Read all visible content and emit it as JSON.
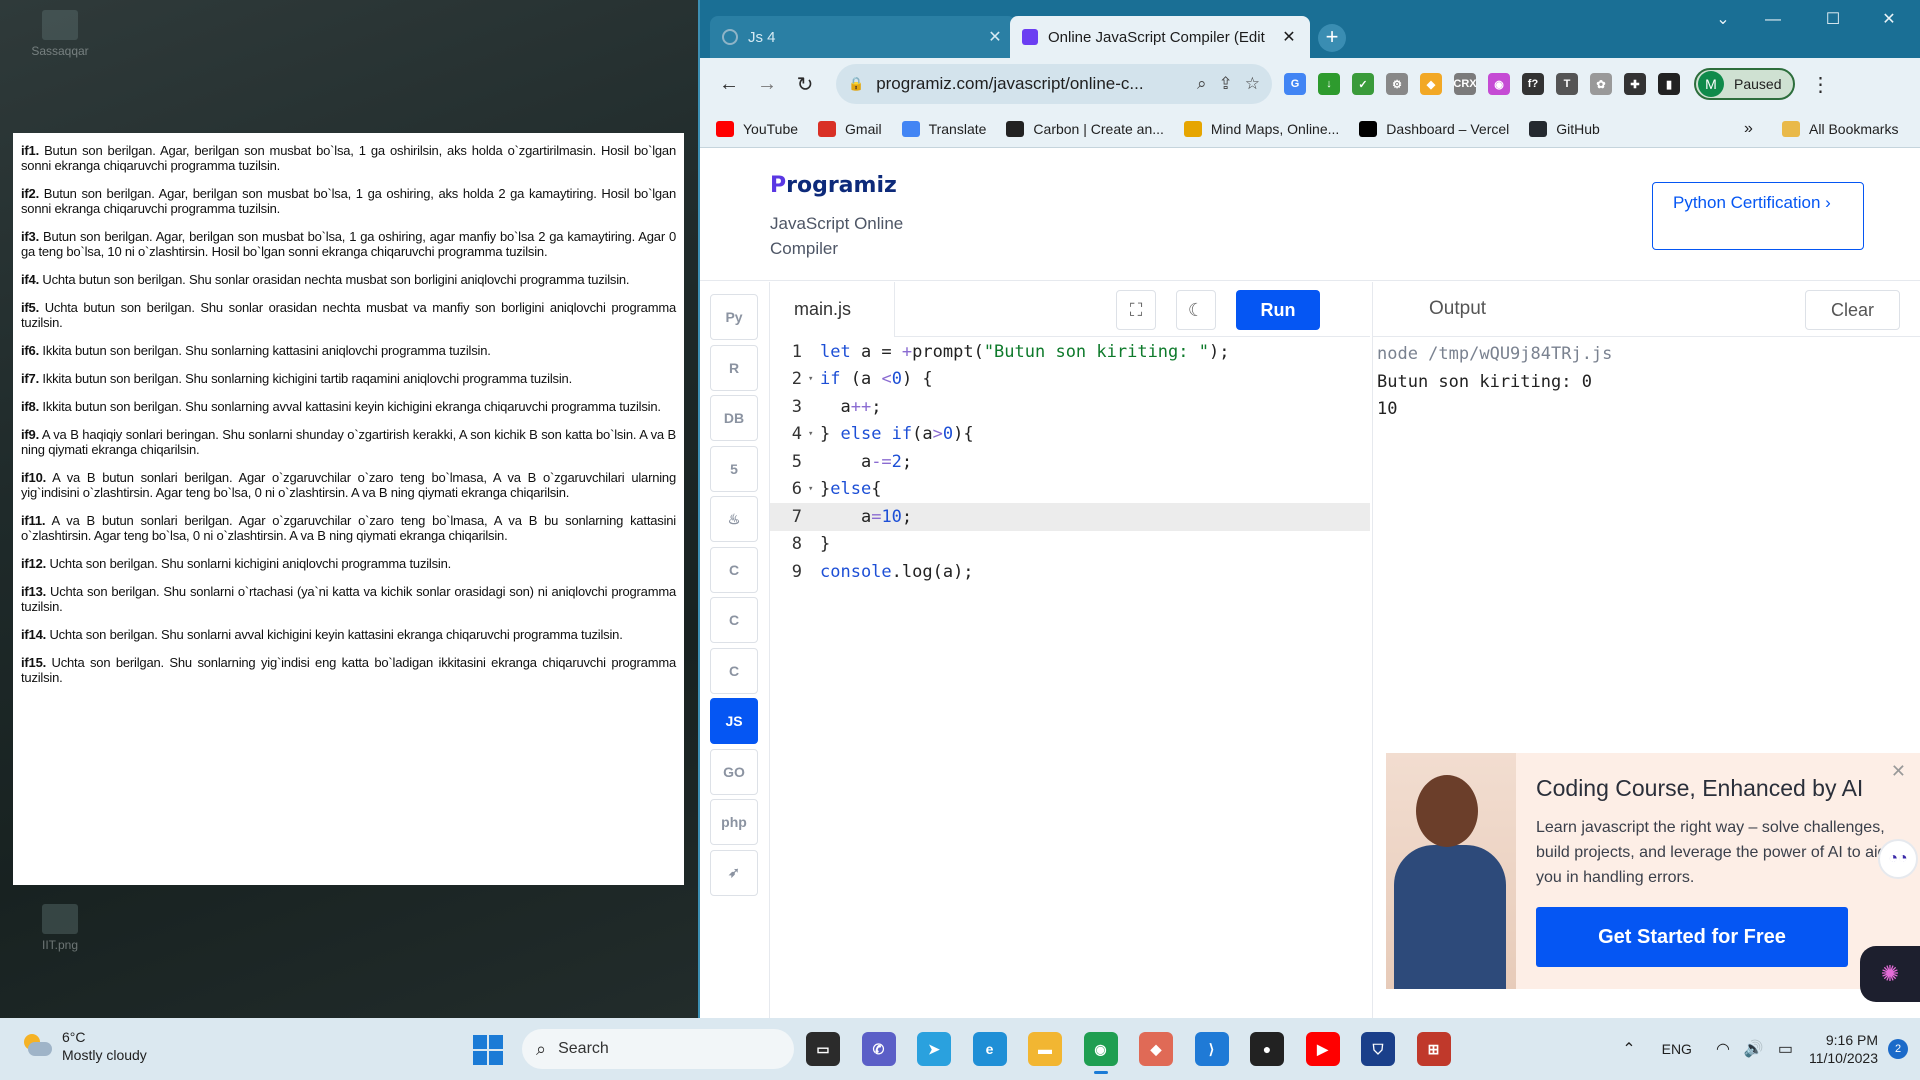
{
  "desktop": {
    "icons": [
      {
        "label": "Sassaqqar"
      },
      {
        "label": "IIT.png"
      }
    ],
    "document": {
      "tasks": [
        {
          "id": "if1.",
          "text": "Butun son berilgan. Agar, berilgan son musbat bo`lsa, 1 ga oshirilsin, aks holda o`zgartirilmasin. Hosil bo`lgan sonni ekranga chiqaruvchi programma tuzilsin."
        },
        {
          "id": "if2.",
          "text": "Butun son berilgan. Agar, berilgan son musbat bo`lsa, 1 ga oshiring, aks holda 2 ga kamaytiring. Hosil bo`lgan sonni ekranga chiqaruvchi programma tuzilsin."
        },
        {
          "id": "if3.",
          "text": "Butun son berilgan. Agar, berilgan son musbat bo`lsa, 1 ga oshiring, agar manfiy bo`lsa 2 ga kamaytiring. Agar 0 ga teng bo`lsa, 10 ni o`zlashtirsin. Hosil bo`lgan sonni ekranga chiqaruvchi programma tuzilsin."
        },
        {
          "id": "if4.",
          "text": "Uchta butun son berilgan. Shu sonlar orasidan nechta musbat son borligini aniqlovchi programma tuzilsin."
        },
        {
          "id": "if5.",
          "text": "Uchta butun son berilgan. Shu sonlar orasidan nechta musbat va manfiy son borligini aniqlovchi programma tuzilsin."
        },
        {
          "id": "if6.",
          "text": "Ikkita butun son berilgan. Shu sonlarning kattasini aniqlovchi programma tuzilsin."
        },
        {
          "id": "if7.",
          "text": "Ikkita butun son berilgan. Shu sonlarning kichigini tartib raqamini aniqlovchi programma tuzilsin."
        },
        {
          "id": "if8.",
          "text": "Ikkita butun son berilgan. Shu sonlarning avval kattasini keyin kichigini ekranga chiqaruvchi programma tuzilsin."
        },
        {
          "id": "if9.",
          "text": "A va B haqiqiy sonlari beringan. Shu sonlarni shunday o`zgartirish kerakki, A son kichik B son katta bo`lsin. A va B ning qiymati ekranga chiqarilsin."
        },
        {
          "id": "if10.",
          "text": "A va B butun sonlari berilgan. Agar o`zgaruvchilar o`zaro teng bo`lmasa, A va B o`zgaruvchilari ularning yig`indisini o`zlashtirsin. Agar teng bo`lsa, 0 ni o`zlashtirsin. A va B ning qiymati ekranga chiqarilsin."
        },
        {
          "id": "if11.",
          "text": "A va B butun sonlari berilgan. Agar o`zgaruvchilar o`zaro teng bo`lmasa, A va B bu sonlarning kattasini o`zlashtirsin. Agar teng bo`lsa, 0 ni o`zlashtirsin. A va B ning qiymati ekranga chiqarilsin."
        },
        {
          "id": "if12.",
          "text": "Uchta son berilgan. Shu sonlarni kichigini aniqlovchi programma tuzilsin."
        },
        {
          "id": "if13.",
          "text": "Uchta son berilgan. Shu sonlarni o`rtachasi (ya`ni katta va kichik sonlar orasidagi son) ni aniqlovchi programma tuzilsin."
        },
        {
          "id": "if14.",
          "text": "Uchta son berilgan. Shu sonlarni avval kichigini keyin kattasini ekranga chiqaruvchi programma tuzilsin."
        },
        {
          "id": "if15.",
          "text": "Uchta son berilgan. Shu sonlarning yig`indisi eng katta bo`ladigan ikkitasini ekranga chiqaruvchi programma tuzilsin."
        }
      ]
    }
  },
  "browser": {
    "tabs": [
      {
        "title": "Js 4",
        "close": "✕"
      },
      {
        "title": "Online JavaScript Compiler (Edit",
        "close": "✕"
      }
    ],
    "new_tab": "+",
    "window_controls": {
      "menu": "⌄",
      "minimize": "—",
      "maximize": "☐",
      "close": "✕"
    },
    "nav": {
      "back": "←",
      "forward": "→",
      "reload": "↻"
    },
    "address": {
      "url": "programiz.com/javascript/online-c...",
      "lock": "🔒"
    },
    "profile": {
      "initial": "M",
      "label": "Paused"
    },
    "bookmarks": [
      {
        "label": "YouTube",
        "color": "#ff0000"
      },
      {
        "label": "Gmail",
        "color": "#d93025"
      },
      {
        "label": "Translate",
        "color": "#4285f4"
      },
      {
        "label": "Carbon | Create an...",
        "color": "#222222"
      },
      {
        "label": "Mind Maps, Online...",
        "color": "#e6a500"
      },
      {
        "label": "Dashboard – Vercel",
        "color": "#000000"
      },
      {
        "label": "GitHub",
        "color": "#24292f"
      }
    ],
    "bookmarks_more": "»",
    "all_bookmarks": "All Bookmarks",
    "extensions": [
      {
        "icon": "google-translate-icon",
        "text": "G",
        "color": "#4285f4"
      },
      {
        "icon": "download-arrow-icon",
        "text": "↓",
        "color": "#2e9b2e"
      },
      {
        "icon": "checkmark-extension-icon",
        "text": "✓",
        "color": "#3a9b3a"
      },
      {
        "icon": "gear-extension-icon",
        "text": "⚙",
        "color": "#888888"
      },
      {
        "icon": "shield-extension-icon",
        "text": "◆",
        "color": "#f2a825"
      },
      {
        "icon": "crx-icon",
        "text": "CRX",
        "color": "#7b7b7b"
      },
      {
        "icon": "colorful-extension-icon",
        "text": "◉",
        "color": "#c54bd4"
      },
      {
        "icon": "function-icon",
        "text": "f?",
        "color": "#333333"
      },
      {
        "icon": "text-tool-icon",
        "text": "T",
        "color": "#555555"
      },
      {
        "icon": "gear-alt-icon",
        "text": "✿",
        "color": "#999999"
      },
      {
        "icon": "puzzle-icon",
        "text": "✚",
        "color": "#333333"
      },
      {
        "icon": "sidebar-icon",
        "text": "▮",
        "color": "#222222"
      }
    ]
  },
  "site": {
    "logo_mark": "P",
    "logo_rest": "rogramiz",
    "subtitle": "JavaScript Online Compiler",
    "cert_button": "Python Certification ›",
    "languages": [
      {
        "name": "python-lang-icon",
        "glyph": "Py"
      },
      {
        "name": "r-lang-icon",
        "glyph": "R"
      },
      {
        "name": "sql-lang-icon",
        "glyph": "DB"
      },
      {
        "name": "html-lang-icon",
        "glyph": "5"
      },
      {
        "name": "java-lang-icon",
        "glyph": "♨"
      },
      {
        "name": "c-lang-icon",
        "glyph": "C"
      },
      {
        "name": "cpp-lang-icon",
        "glyph": "C"
      },
      {
        "name": "csharp-lang-icon",
        "glyph": "C"
      },
      {
        "name": "js-lang-icon",
        "glyph": "JS",
        "active": true
      },
      {
        "name": "go-lang-icon",
        "glyph": "GO"
      },
      {
        "name": "php-lang-icon",
        "glyph": "php"
      },
      {
        "name": "swift-lang-icon",
        "glyph": "➶"
      }
    ],
    "editor": {
      "filename": "main.js",
      "run_label": "Run",
      "lines": [
        {
          "n": "1",
          "fold": "",
          "html": "<span class=\"kw\">let</span> a = <span class=\"op\">+</span>prompt(<span class=\"str\">\"Butun son kiriting: \"</span>);"
        },
        {
          "n": "2",
          "fold": "▾",
          "html": "<span class=\"kw\">if</span> (a <span class=\"op\">&lt;</span><span class=\"num\">0</span>) {"
        },
        {
          "n": "3",
          "fold": "",
          "html": "  a<span class=\"op\">++</span>;"
        },
        {
          "n": "4",
          "fold": "▾",
          "html": "} <span class=\"kw\">else if</span>(a<span class=\"op\">&gt;</span><span class=\"num\">0</span>){"
        },
        {
          "n": "5",
          "fold": "",
          "html": "    a<span class=\"op\">-=</span><span class=\"num\">2</span>;"
        },
        {
          "n": "6",
          "fold": "▾",
          "html": "}<span class=\"kw\">else</span>{"
        },
        {
          "n": "7",
          "fold": "",
          "html": "    a<span class=\"op\">=</span><span class=\"num\">10</span>;",
          "current": true
        },
        {
          "n": "8",
          "fold": "",
          "html": "}"
        },
        {
          "n": "9",
          "fold": "",
          "html": "<span class=\"kw\">console</span>.log(a);"
        }
      ]
    },
    "output": {
      "title": "Output",
      "clear_label": "Clear",
      "lines": [
        "node /tmp/wQU9j84TRj.js",
        "Butun son kiriting: 0",
        "10"
      ]
    },
    "ad": {
      "title": "Coding Course, Enhanced by AI",
      "text": "Learn javascript the right way – solve challenges, build projects, and leverage the power of AI to aid you in handling errors.",
      "cta": "Get Started for Free",
      "close": "✕"
    }
  },
  "taskbar": {
    "weather": {
      "temp": "6°C",
      "condition": "Mostly cloudy"
    },
    "search_placeholder": "Search",
    "apps": [
      {
        "name": "task-view-icon",
        "glyph": "▭",
        "color": "#2b2b2b"
      },
      {
        "name": "teams-chat-icon",
        "glyph": "✆",
        "color": "#5b5fc7"
      },
      {
        "name": "telegram-icon",
        "glyph": "➤",
        "color": "#2aa1de"
      },
      {
        "name": "edge-icon",
        "glyph": "e",
        "color": "#1f8fd6"
      },
      {
        "name": "file-explorer-icon",
        "glyph": "▬",
        "color": "#f2b632"
      },
      {
        "name": "chrome-icon",
        "glyph": "◉",
        "color": "#1f9e51",
        "active": true
      },
      {
        "name": "photos-icon",
        "glyph": "◆",
        "color": "#e06a56"
      },
      {
        "name": "vscode-icon",
        "glyph": "⟩",
        "color": "#1f7ad6"
      },
      {
        "name": "obs-icon",
        "glyph": "●",
        "color": "#222222"
      },
      {
        "name": "youtube-icon",
        "glyph": "▶",
        "color": "#ff0000"
      },
      {
        "name": "vpn-shield-icon",
        "glyph": "⛉",
        "color": "#1a3f8a"
      },
      {
        "name": "flag-app-icon",
        "glyph": "⊞",
        "color": "#c0392b"
      }
    ],
    "tray": {
      "chevron": "⌃",
      "lang": "ENG",
      "wifi": "◠",
      "volume": "🔊",
      "battery": "▭",
      "time": "9:16 PM",
      "date": "11/10/2023",
      "notifications": "2"
    }
  }
}
